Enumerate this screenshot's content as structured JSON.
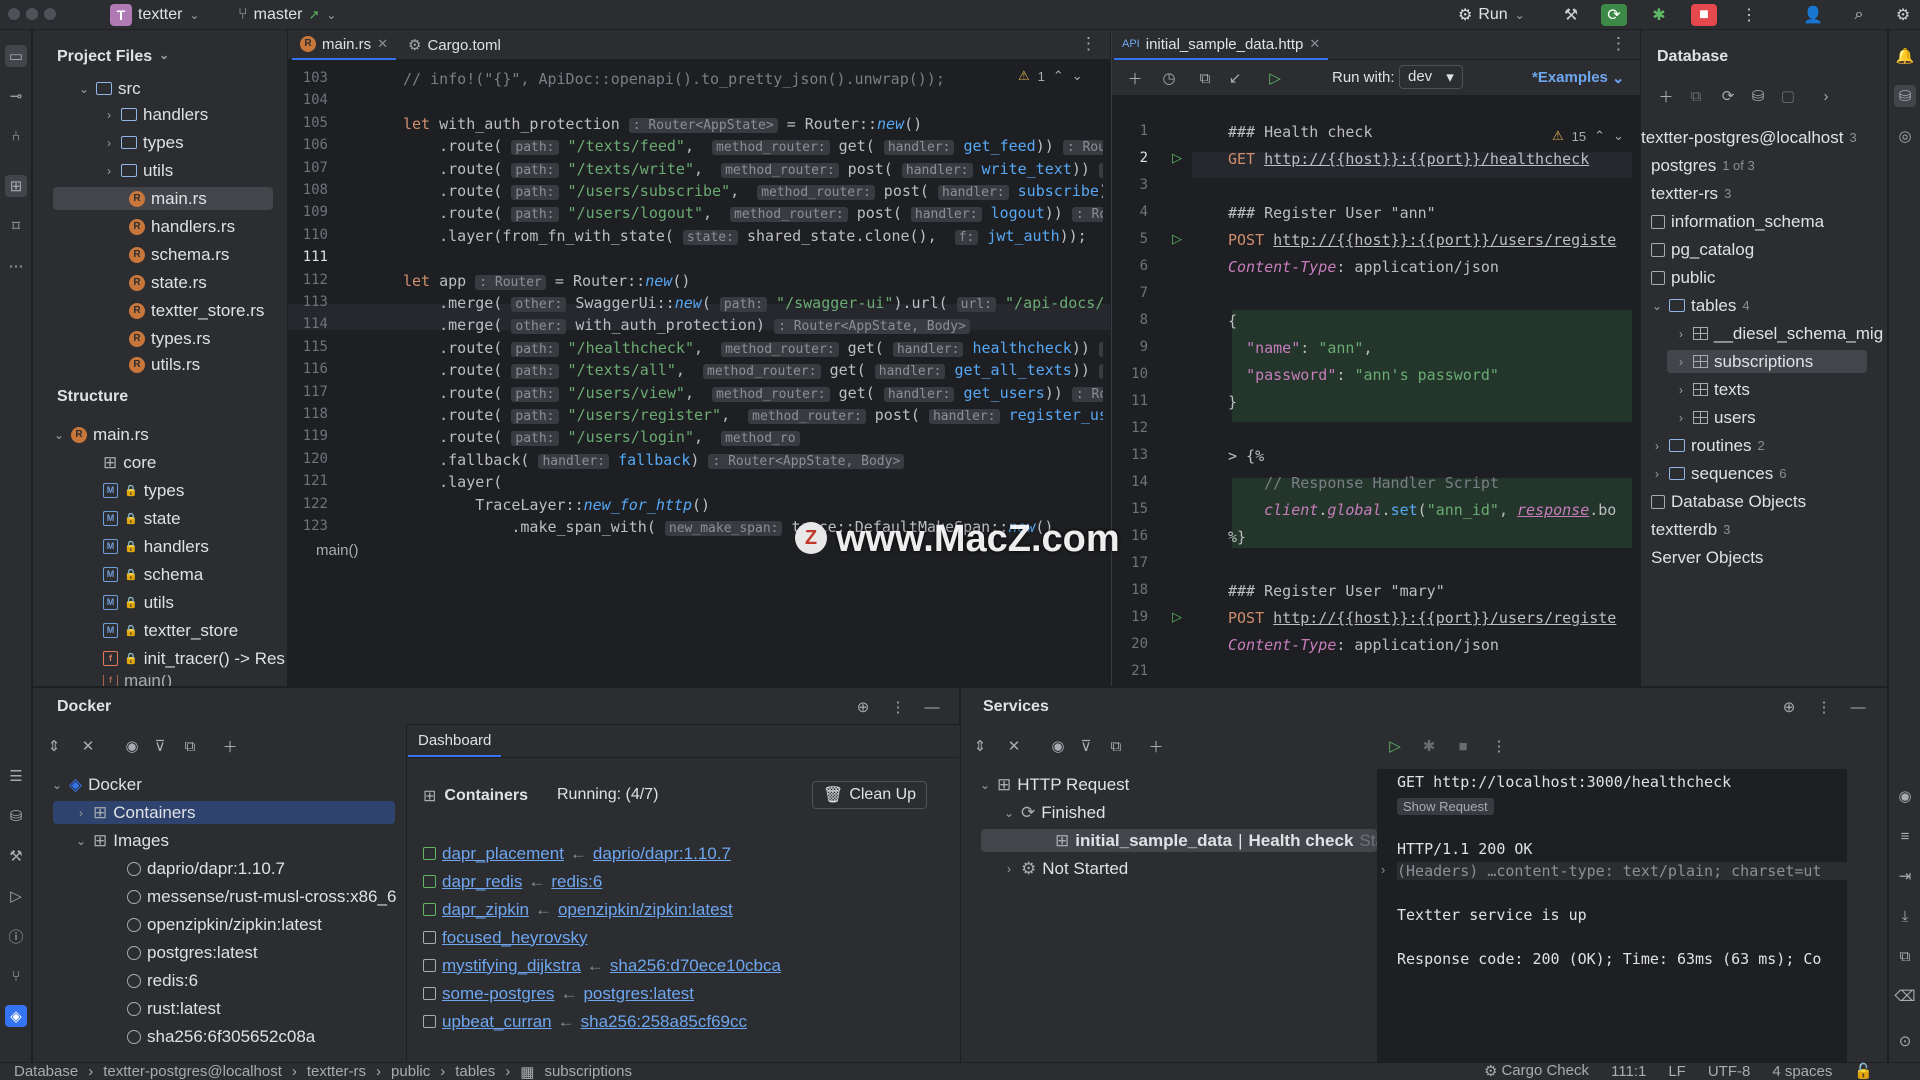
{
  "titlebar": {
    "project_badge": "T",
    "project_name": "textter",
    "branch": "master",
    "branch_arrow": "↗",
    "run_label": "Run"
  },
  "project_panel": {
    "title": "Project Files",
    "items": [
      {
        "label": "src",
        "kind": "folder"
      },
      {
        "label": "handlers",
        "kind": "folder"
      },
      {
        "label": "types",
        "kind": "folder"
      },
      {
        "label": "utils",
        "kind": "folder"
      },
      {
        "label": "main.rs",
        "kind": "rs"
      },
      {
        "label": "handlers.rs",
        "kind": "rs"
      },
      {
        "label": "schema.rs",
        "kind": "rs"
      },
      {
        "label": "state.rs",
        "kind": "rs"
      },
      {
        "label": "textter_store.rs",
        "kind": "rs"
      },
      {
        "label": "types.rs",
        "kind": "rs"
      },
      {
        "label": "utils.rs",
        "kind": "rs"
      }
    ]
  },
  "structure_panel": {
    "title": "Structure",
    "items": [
      {
        "label": "main.rs"
      },
      {
        "label": "core"
      },
      {
        "label": "types"
      },
      {
        "label": "state"
      },
      {
        "label": "handlers"
      },
      {
        "label": "schema"
      },
      {
        "label": "utils"
      },
      {
        "label": "textter_store"
      },
      {
        "label": "init_tracer() -> Res"
      },
      {
        "label": "main()"
      }
    ]
  },
  "editor_left": {
    "tabs": [
      "main.rs",
      "Cargo.toml"
    ],
    "warning_count": "1",
    "breadcrumb": "main()",
    "line_numbers": [
      "103",
      "104",
      "105",
      "106",
      "107",
      "108",
      "109",
      "110",
      "111",
      "112",
      "113",
      "114",
      "115",
      "116",
      "117",
      "118",
      "119",
      "120",
      "121",
      "122",
      "123"
    ]
  },
  "editor_right": {
    "tab": "initial_sample_data.http",
    "tab_prefix": "API",
    "run_with_label": "Run with:",
    "env": "dev",
    "examples": "*Examples",
    "warning_count": "15",
    "line_numbers": [
      "1",
      "2",
      "3",
      "4",
      "5",
      "6",
      "7",
      "8",
      "9",
      "10",
      "11",
      "12",
      "13",
      "14",
      "15",
      "16",
      "17",
      "18",
      "19",
      "20",
      "21"
    ]
  },
  "database_panel": {
    "title": "Database",
    "items": [
      {
        "label": "textter-postgres@localhost",
        "count": "3"
      },
      {
        "label": "postgres",
        "count": "1 of 3"
      },
      {
        "label": "textter-rs",
        "count": "3"
      },
      {
        "label": "information_schema",
        "count": ""
      },
      {
        "label": "pg_catalog",
        "count": ""
      },
      {
        "label": "public",
        "count": ""
      },
      {
        "label": "tables",
        "count": "4"
      },
      {
        "label": "__diesel_schema_mig",
        "count": ""
      },
      {
        "label": "subscriptions",
        "count": ""
      },
      {
        "label": "texts",
        "count": ""
      },
      {
        "label": "users",
        "count": ""
      },
      {
        "label": "routines",
        "count": "2"
      },
      {
        "label": "sequences",
        "count": "6"
      },
      {
        "label": "Database Objects",
        "count": ""
      },
      {
        "label": "textterdb",
        "count": "3"
      },
      {
        "label": "Server Objects",
        "count": ""
      }
    ]
  },
  "docker_panel": {
    "title": "Docker",
    "dashboard_tab": "Dashboard",
    "tree": [
      {
        "label": "Docker"
      },
      {
        "label": "Containers"
      },
      {
        "label": "Images"
      },
      {
        "label": "daprio/dapr:1.10.7"
      },
      {
        "label": "messense/rust-musl-cross:x86_6"
      },
      {
        "label": "openzipkin/zipkin:latest"
      },
      {
        "label": "postgres:latest"
      },
      {
        "label": "redis:6"
      },
      {
        "label": "rust:latest"
      },
      {
        "label": "sha256:6f305652c08a"
      }
    ],
    "containers_label": "Containers",
    "running": "Running: (4/7)",
    "cleanup": "Clean Up",
    "containers": [
      {
        "name": "dapr_placement",
        "image": "daprio/dapr:1.10.7",
        "running": true
      },
      {
        "name": "dapr_redis",
        "image": "redis:6",
        "running": true
      },
      {
        "name": "dapr_zipkin",
        "image": "openzipkin/zipkin:latest",
        "running": true
      },
      {
        "name": "focused_heyrovsky",
        "image": "",
        "running": false
      },
      {
        "name": "mystifying_dijkstra",
        "image": "sha256:d70ece10cbca",
        "running": false
      },
      {
        "name": "some-postgres",
        "image": "postgres:latest",
        "running": false
      },
      {
        "name": "upbeat_curran",
        "image": "sha256:258a85cf69cc",
        "running": false
      }
    ]
  },
  "services_panel": {
    "title": "Services",
    "tree": [
      {
        "label": "HTTP Request"
      },
      {
        "label": "Finished"
      },
      {
        "label": "initial_sample_data",
        "extra": "Health check",
        "tail": "Sta"
      },
      {
        "label": "Not Started"
      }
    ],
    "output": {
      "request": "GET http://localhost:3000/healthcheck",
      "show_request": "Show Request",
      "status": "HTTP/1.1 200 OK",
      "headers": "(Headers) …content-type: text/plain; charset=ut",
      "body": "Textter service is up",
      "response": "Response code: 200 (OK); Time: 63ms (63 ms); Co"
    }
  },
  "statusbar": {
    "breadcrumb": [
      "Database",
      "textter-postgres@localhost",
      "textter-rs",
      "public",
      "tables",
      "subscriptions"
    ],
    "cargo_check": "Cargo Check",
    "position": "111:1",
    "line_sep": "LF",
    "encoding": "UTF-8",
    "indent": "4 spaces"
  },
  "watermark": {
    "logo": "Z",
    "text": "www.MacZ.com"
  },
  "colors": {
    "accent": "#3574f0",
    "run_green": "#5fb865",
    "stop_red": "#e5484d",
    "link": "#6ea6f0"
  }
}
